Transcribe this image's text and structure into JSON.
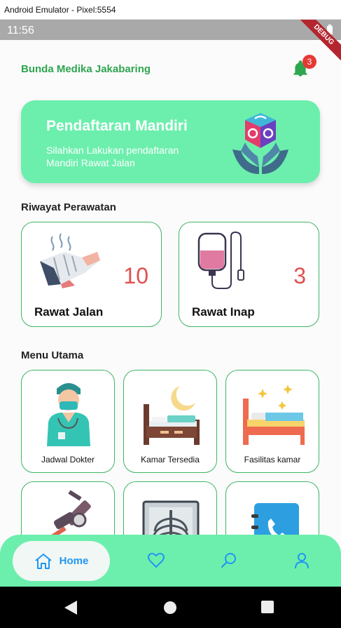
{
  "window": {
    "title": "Android Emulator - Pixel:5554"
  },
  "status_bar": {
    "time": "11:56",
    "debug_label": "DEBUG"
  },
  "header": {
    "title": "Bunda Medika Jakabaring",
    "notification_count": "3"
  },
  "banner": {
    "title": "Pendaftaran Mandiri",
    "subtitle": "Silahkan Lakukan pendaftaran Mandiri Rawat Jalan"
  },
  "riwayat": {
    "title": "Riwayat Perawatan",
    "cards": [
      {
        "label": "Rawat Jalan",
        "count": "10",
        "icon": "injured-foot-icon"
      },
      {
        "label": "Rawat Inap",
        "count": "3",
        "icon": "iv-drip-icon"
      }
    ]
  },
  "menu": {
    "title": "Menu Utama",
    "items": [
      {
        "label": "Jadwal Dokter",
        "icon": "doctor-icon"
      },
      {
        "label": "Kamar Tersedia",
        "icon": "bed-night-icon"
      },
      {
        "label": "Fasilitas kamar",
        "icon": "bed-facility-icon"
      },
      {
        "label": "",
        "icon": "microscope-icon"
      },
      {
        "label": "",
        "icon": "xray-icon"
      },
      {
        "label": "",
        "icon": "phone-book-icon"
      }
    ]
  },
  "bottom_nav": {
    "home_label": "Home",
    "items": [
      "home-icon",
      "heart-icon",
      "search-icon",
      "user-icon"
    ]
  },
  "colors": {
    "accent": "#6cefad",
    "brand_green": "#2ea54f",
    "card_border": "#3eb564",
    "count_red": "#e05050",
    "nav_blue": "#2196f3"
  }
}
